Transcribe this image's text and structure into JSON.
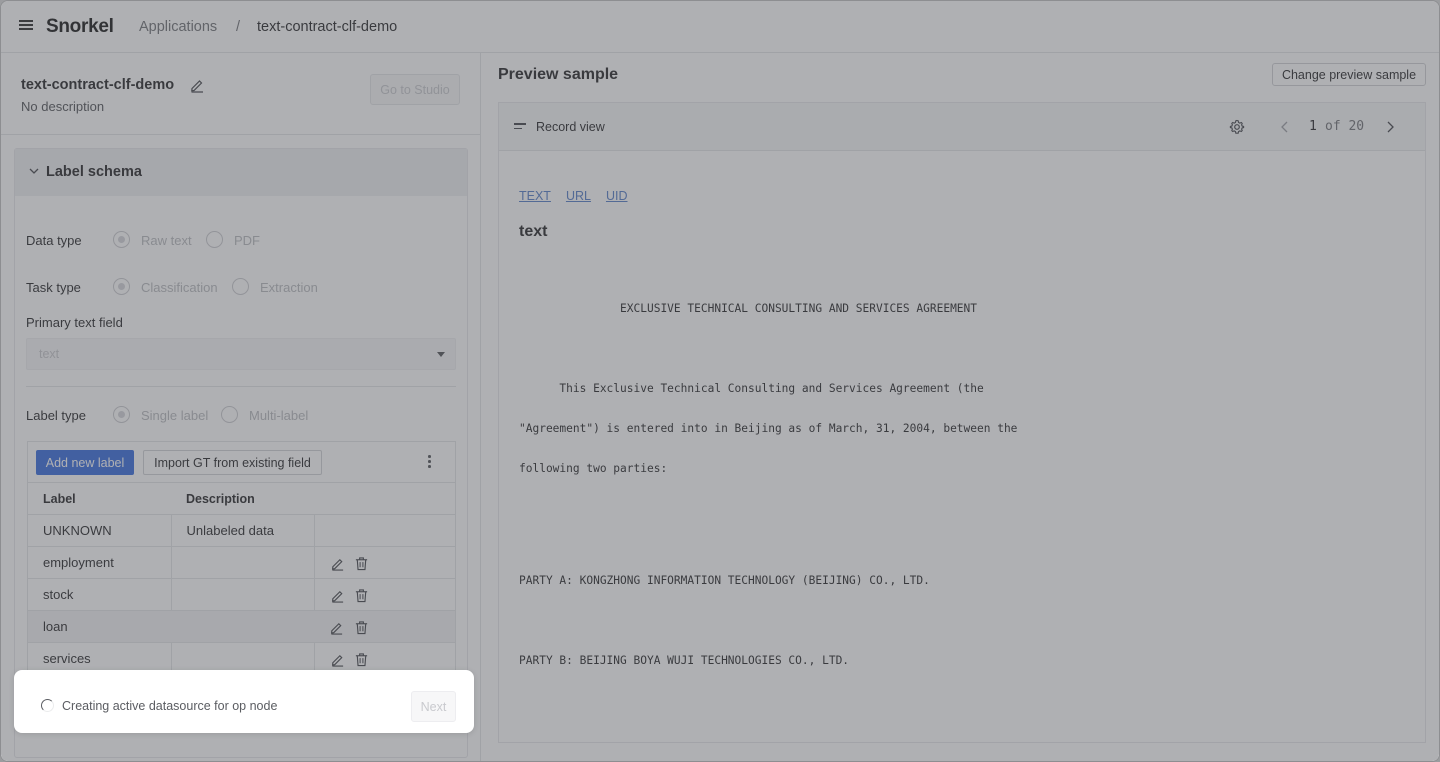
{
  "header": {
    "logo": "Snorkel",
    "breadcrumb": {
      "root": "Applications",
      "separator": "/",
      "current": "text-contract-clf-demo"
    }
  },
  "left": {
    "app_name": "text-contract-clf-demo",
    "app_description": "No description",
    "go_to_studio": "Go to Studio",
    "schema": {
      "title": "Label schema",
      "data_type": {
        "label": "Data type",
        "options": [
          "Raw text",
          "PDF"
        ],
        "selected": "Raw text"
      },
      "task_type": {
        "label": "Task type",
        "options": [
          "Classification",
          "Extraction"
        ],
        "selected": "Classification"
      },
      "primary_text_field": {
        "label": "Primary text field",
        "value": "text"
      },
      "label_type": {
        "label": "Label type",
        "options": [
          "Single label",
          "Multi-label"
        ],
        "selected": "Single label"
      },
      "add_new_label": "Add new label",
      "import_gt": "Import GT from existing field",
      "table": {
        "headers": [
          "Label",
          "Description"
        ],
        "rows": [
          {
            "label": "UNKNOWN",
            "description": "Unlabeled data",
            "editable": false
          },
          {
            "label": "employment",
            "description": "",
            "editable": true
          },
          {
            "label": "stock",
            "description": "",
            "editable": true
          },
          {
            "label": "loan",
            "description": "",
            "editable": true
          },
          {
            "label": "services",
            "description": "",
            "editable": true
          }
        ]
      }
    },
    "status": {
      "message": "Creating active datasource for op node",
      "next": "Next"
    }
  },
  "preview": {
    "title": "Preview sample",
    "change_sample": "Change preview sample",
    "view_label": "Record view",
    "pagination": {
      "current": "1",
      "total_text": "of 20"
    },
    "field_links": [
      "TEXT",
      "URL",
      "UID"
    ],
    "field_name": "text",
    "doc_lines": [
      "               EXCLUSIVE TECHNICAL CONSULTING AND SERVICES AGREEMENT",
      "      This Exclusive Technical Consulting and Services Agreement (the",
      "\"Agreement\") is entered into in Beijing as of March, 31, 2004, between the",
      "following two parties:",
      "PARTY A: KONGZHONG INFORMATION TECHNOLOGY (BEIJING) CO., LTD.",
      "PARTY B: BEIJING BOYA WUJI TECHNOLOGIES CO., LTD."
    ]
  },
  "colors": {
    "accent": "#2f66dd",
    "link": "#4f79c6",
    "overlay": "#585a60"
  },
  "icons": [
    "menu-icon",
    "pencil-icon",
    "chevron-down-icon",
    "kebab-menu-icon",
    "trash-icon",
    "spinner-icon",
    "list-icon",
    "gear-icon",
    "chevron-left-icon",
    "chevron-right-icon"
  ]
}
